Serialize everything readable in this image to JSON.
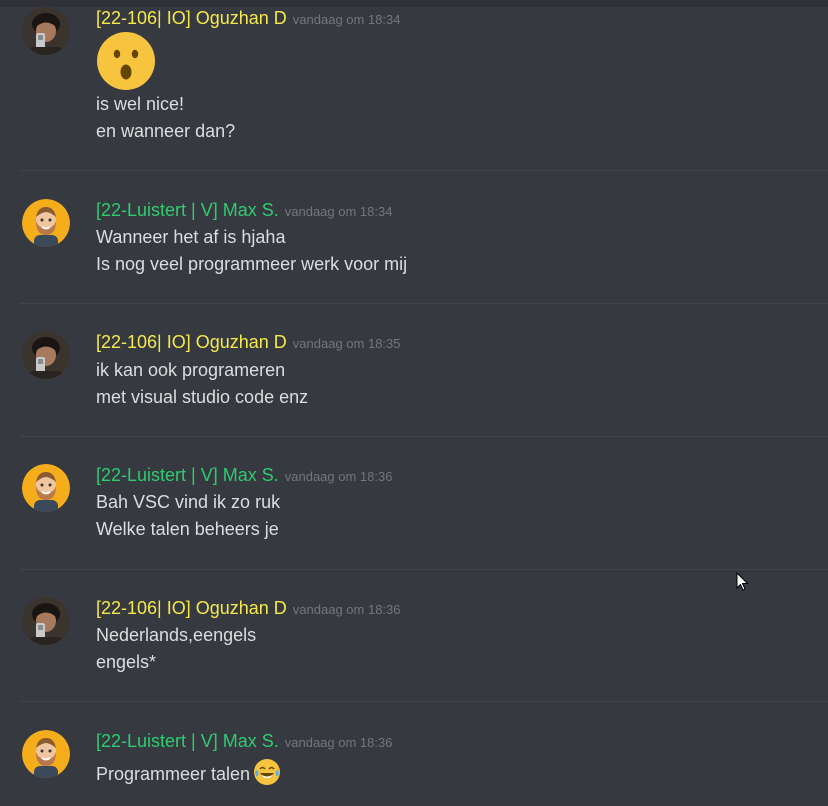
{
  "messages": [
    {
      "author": "[22-106| IO] Oguzhan D",
      "author_color": "#f5e94d",
      "time": "vandaag om 18:34",
      "emoji": "hushed-face-icon",
      "lines": [
        "is wel nice!",
        "en wanneer dan?"
      ]
    },
    {
      "author": "[22-Luistert | V] Max S.",
      "author_color": "#2ecc71",
      "time": "vandaag om 18:34",
      "lines": [
        "Wanneer het af is hjaha",
        "Is nog veel programmeer werk voor mij"
      ]
    },
    {
      "author": "[22-106| IO] Oguzhan D",
      "author_color": "#f5e94d",
      "time": "vandaag om 18:35",
      "lines": [
        "ik kan ook programeren",
        "met visual studio code enz"
      ]
    },
    {
      "author": "[22-Luistert | V] Max S.",
      "author_color": "#2ecc71",
      "time": "vandaag om 18:36",
      "lines": [
        "Bah VSC vind ik zo ruk",
        "Welke talen beheers je"
      ]
    },
    {
      "author": "[22-106| IO] Oguzhan D",
      "author_color": "#f5e94d",
      "time": "vandaag om 18:36",
      "lines": [
        "Nederlands,eengels",
        "engels*"
      ]
    },
    {
      "author": "[22-Luistert | V] Max S.",
      "author_color": "#2ecc71",
      "time": "vandaag om 18:36",
      "lines": [
        "Programmeer talen"
      ],
      "emoji": "joy-face-icon"
    }
  ]
}
